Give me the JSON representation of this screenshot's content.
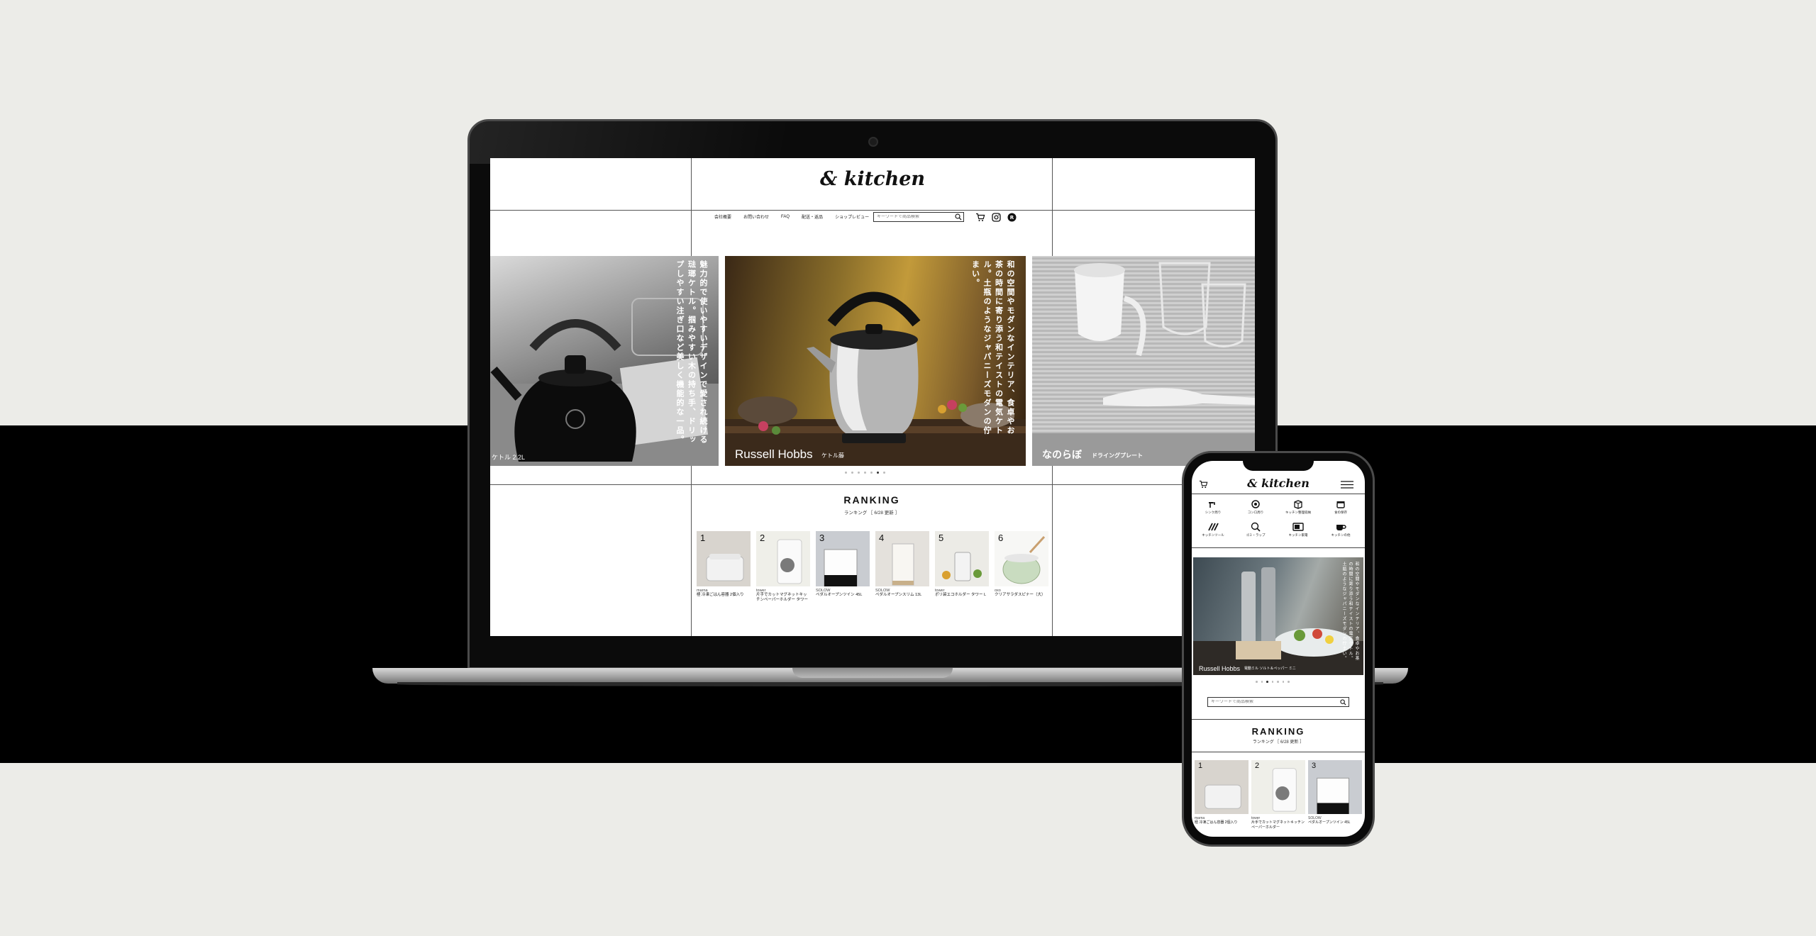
{
  "site": {
    "brand": "& kitchen",
    "nav": [
      "会社概要",
      "お問い合わせ",
      "FAQ",
      "配送・返品",
      "ショップレビュー"
    ],
    "search_placeholder": "キーワードで商品検索"
  },
  "hero": {
    "slides": [
      {
        "caption": "魅力的で使いやすいデザインで愛され続ける琺瑯ケトル。掴みやすい木の持ち手、ドリップしやすい注ぎ口など美しく機能的な一品。",
        "label": "ケトル 2.2L"
      },
      {
        "caption": "和の空間やモダンなインテリア、食卓やお茶の時間に寄り添う和テイストの電気ケトル。土瓶のようなジャパニーズモダンの佇まい。",
        "brand_label": "Russell Hobbs",
        "label": "ケトル藤"
      },
      {
        "brand_label": "なのらぼ",
        "label": "ドライングプレート"
      }
    ],
    "dot_count": 7,
    "active_dot": 5
  },
  "ranking": {
    "title": "RANKING",
    "subtitle": "ランキング ［ 6/28 更新 ］",
    "items": [
      {
        "rank": "1",
        "brand": "marna",
        "name": "極 冷凍ごはん容器 2個入り"
      },
      {
        "rank": "2",
        "brand": "tower",
        "name": "片手でカットマグネットキッチンペーパーホルダー タワー"
      },
      {
        "rank": "3",
        "brand": "SOLOW",
        "name": "ペダルオープンツイン 45L"
      },
      {
        "rank": "4",
        "brand": "SOLOW",
        "name": "ペダルオープンスリム 13L"
      },
      {
        "rank": "5",
        "brand": "tower",
        "name": "ポリ袋エコホルダー タワー L"
      },
      {
        "rank": "6",
        "brand": "oxo",
        "name": "クリアサラダスピナー（大）"
      }
    ]
  },
  "mobile": {
    "brand": "& kitchen",
    "categories": [
      "シンク周り",
      "コンロ周り",
      "キッチン整理収納",
      "食の保存",
      "キッチンツール",
      "ゴミ・ラップ",
      "キッチン家電",
      "キッチンの他"
    ],
    "hero_brand": "Russell Hobbs",
    "hero_label": "電動ミル ソルト＆ペッパー ミニ",
    "search_placeholder": "キーワードで商品検索",
    "ranking_title": "RANKING",
    "ranking_subtitle": "ランキング ［ 6/28 更新 ］",
    "ranking_items": [
      {
        "rank": "1",
        "brand": "marna",
        "name": "極 冷凍ごはん容器 2個入り"
      },
      {
        "rank": "2",
        "brand": "tower",
        "name": "片手でカットマグネットキッチンペーパーホルダー"
      },
      {
        "rank": "3",
        "brand": "SOLOW",
        "name": "ペダルオープンツイン 45L"
      }
    ]
  }
}
